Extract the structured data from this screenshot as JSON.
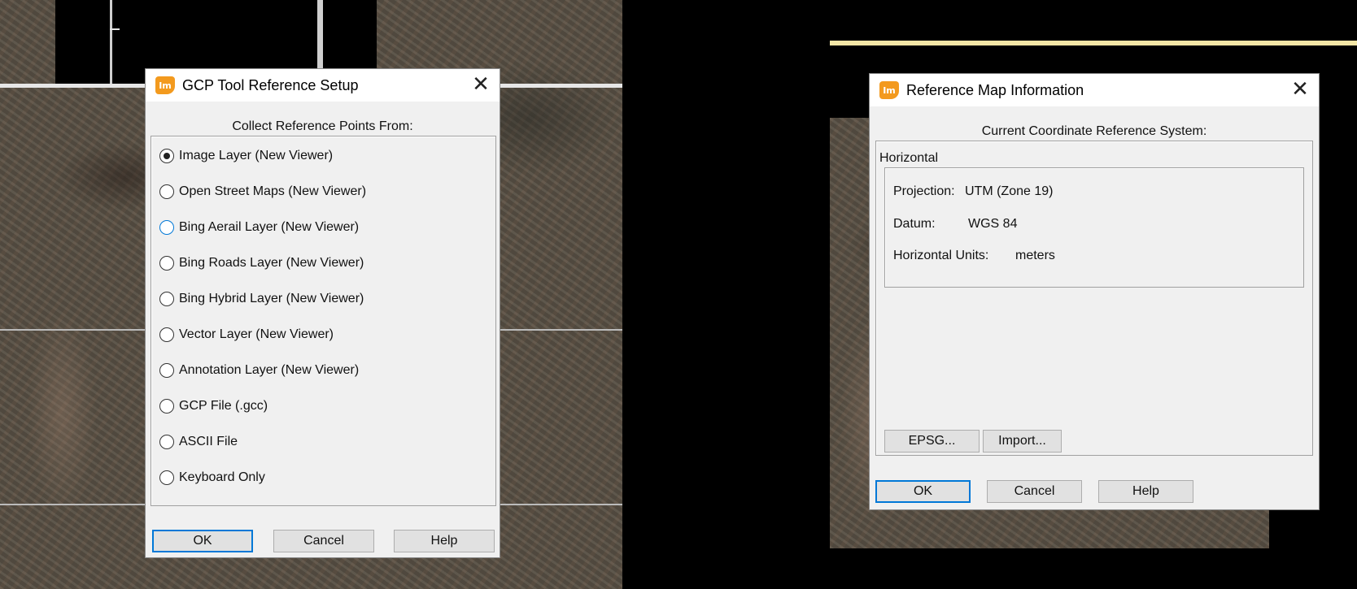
{
  "gcp_dialog": {
    "title": "GCP Tool Reference Setup",
    "app_icon": "Im",
    "section_label": "Collect Reference Points From:",
    "options": [
      {
        "label": "Image Layer (New Viewer)"
      },
      {
        "label": "Open Street Maps (New Viewer)"
      },
      {
        "label": "Bing Aerail Layer (New Viewer)"
      },
      {
        "label": "Bing Roads Layer (New Viewer)"
      },
      {
        "label": "Bing Hybrid Layer (New Viewer)"
      },
      {
        "label": "Vector Layer (New Viewer)"
      },
      {
        "label": "Annotation Layer (New Viewer)"
      },
      {
        "label": "GCP File (.gcc)"
      },
      {
        "label": "ASCII File"
      },
      {
        "label": "Keyboard Only"
      }
    ],
    "selected_option": "Image Layer (New Viewer)",
    "buttons": {
      "ok": "OK",
      "cancel": "Cancel",
      "help": "Help"
    }
  },
  "ref_dialog": {
    "title": "Reference Map Information",
    "app_icon": "Im",
    "section_label": "Current Coordinate Reference System:",
    "group_label": "Horizontal",
    "projection_label": "Projection:",
    "projection_value": "UTM (Zone 19)",
    "datum_label": "Datum:",
    "datum_value": "WGS 84",
    "units_label": "Horizontal Units:",
    "units_value": "meters",
    "buttons": {
      "epsg": "EPSG...",
      "import": "Import...",
      "ok": "OK",
      "cancel": "Cancel",
      "help": "Help"
    }
  },
  "icons": {
    "close": "close-icon",
    "app": "imagine-app-icon",
    "close_glyph": "✕"
  },
  "colors": {
    "accent": "#0078d7",
    "app_icon": "#f39a1e",
    "dialog_bg": "#f0f0f0"
  }
}
